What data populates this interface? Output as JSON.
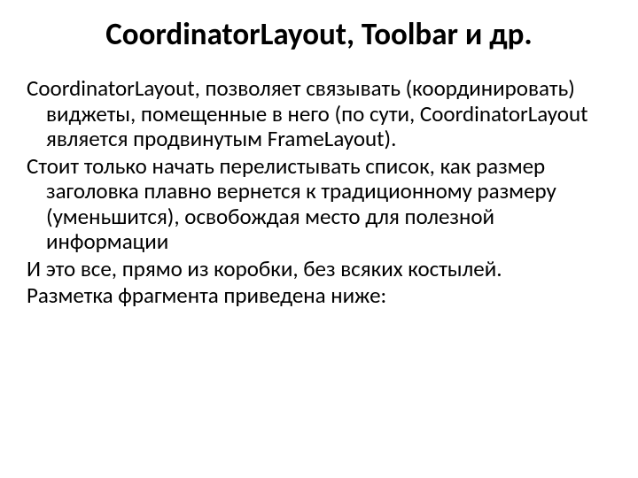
{
  "slide": {
    "title": "CoordinatorLayout, Toolbar и др.",
    "paragraphs": [
      "CoordinatorLayout, позволяет связывать (координировать) виджеты, помещенные в него (по сути, CoordinatorLayout является продвинутым FrameLayout).",
      "Стоит только начать перелистывать список, как размер заголовка плавно вернется к традиционному размеру (уменьшится), освобождая место для полезной информации",
      "И это все, прямо из коробки, без всяких костылей.",
      "Разметка фрагмента приведена ниже:"
    ]
  }
}
